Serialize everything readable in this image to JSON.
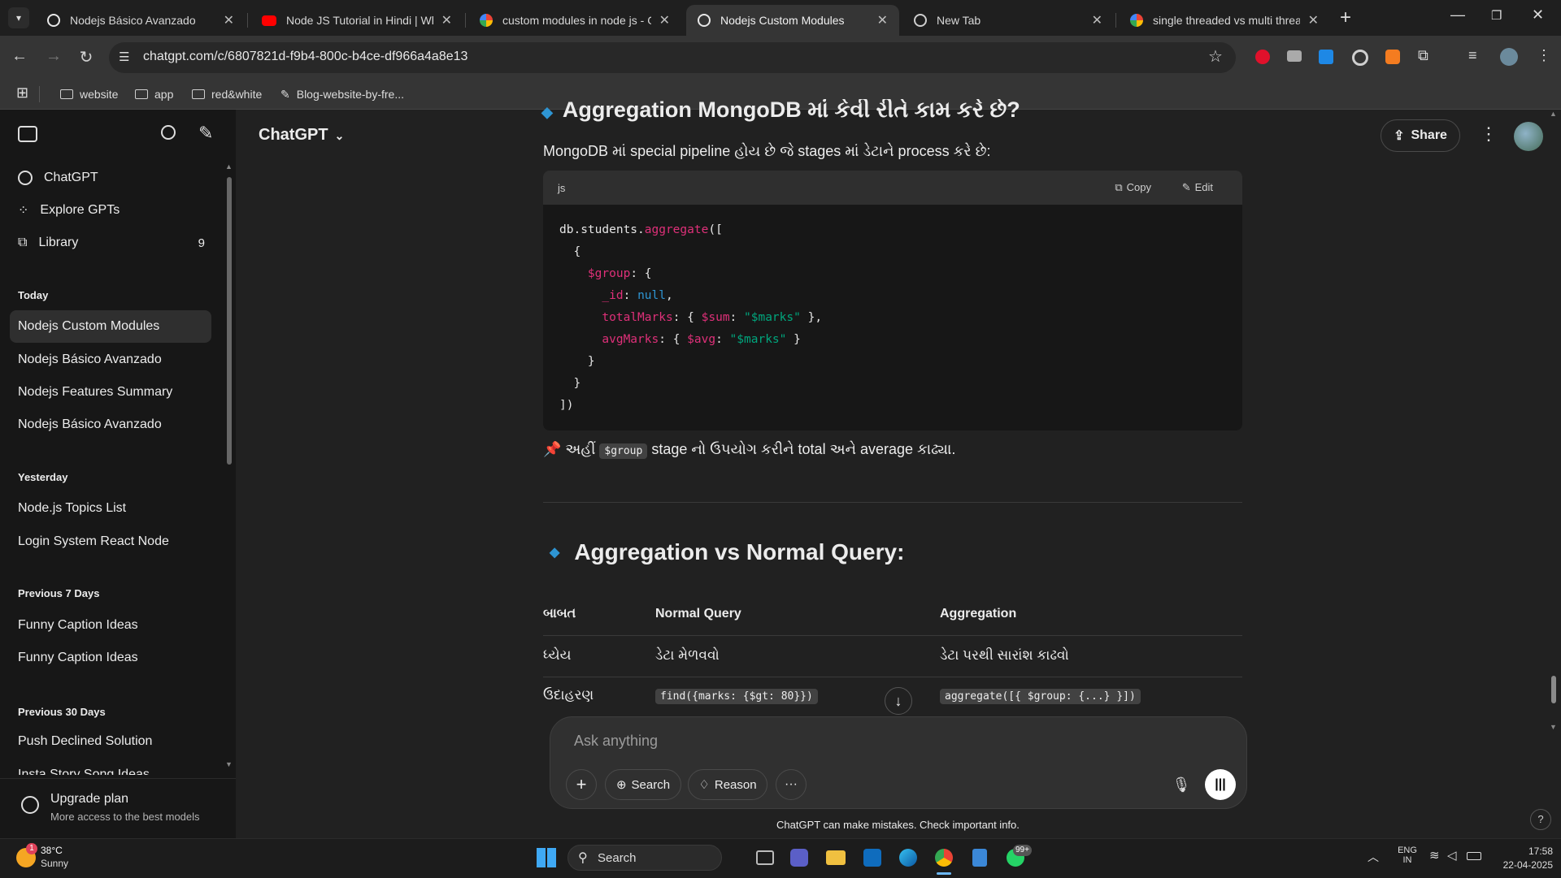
{
  "browser": {
    "tabs": [
      {
        "title": "Nodejs Básico Avanzado",
        "icon": "chatgpt-icon",
        "color": "#ffffff"
      },
      {
        "title": "Node JS Tutorial in Hindi | What",
        "icon": "youtube-icon",
        "color": "#ff0000"
      },
      {
        "title": "custom modules in node js - Go",
        "icon": "google-icon",
        "color": "#4285f4"
      },
      {
        "title": "Nodejs Custom Modules",
        "icon": "chatgpt-icon",
        "color": "#ffffff"
      },
      {
        "title": "New Tab",
        "icon": "chrome-icon",
        "color": "#ffffff"
      },
      {
        "title": "single threaded vs multi thread",
        "icon": "google-icon",
        "color": "#4285f4"
      }
    ],
    "url": "chatgpt.com/c/6807821d-f9b4-800c-b4ce-df966a4a8e13",
    "bookmarks": [
      "website",
      "app",
      "red&white",
      "Blog-website-by-fre..."
    ]
  },
  "sidebar": {
    "top_items": [
      {
        "label": "ChatGPT",
        "icon": "chatgpt-icon"
      },
      {
        "label": "Explore GPTs",
        "icon": "grid-icon"
      },
      {
        "label": "Library",
        "icon": "library-icon",
        "count": "9"
      }
    ],
    "sections": [
      {
        "title": "Today",
        "items": [
          "Nodejs Custom Modules",
          "Nodejs Básico Avanzado",
          "Nodejs Features Summary",
          "Nodejs Básico Avanzado"
        ]
      },
      {
        "title": "Yesterday",
        "items": [
          "Node.js Topics List",
          "Login System React Node"
        ]
      },
      {
        "title": "Previous 7 Days",
        "items": [
          "Funny Caption Ideas",
          "Funny Caption Ideas"
        ]
      },
      {
        "title": "Previous 30 Days",
        "items": [
          "Push Declined Solution",
          "Insta Story Song Ideas"
        ]
      }
    ],
    "upgrade": {
      "title": "Upgrade plan",
      "subtitle": "More access to the best models"
    }
  },
  "header": {
    "model": "ChatGPT",
    "share": "Share"
  },
  "content": {
    "partial_heading": "Aggregation MongoDB માં કેવી રીતે કામ કરે છે?",
    "intro": "MongoDB માં special pipeline હોય છે જે stages માં ડેટાને process કરે છે:",
    "code": {
      "lang": "js",
      "copy": "Copy",
      "edit": "Edit",
      "lines": [
        "db.students.aggregate([",
        "  {",
        "    $group: {",
        "      _id: null,",
        "      totalMarks: { $sum: \"$marks\" },",
        "      avgMarks: { $avg: \"$marks\" }",
        "    }",
        "  }",
        "])"
      ]
    },
    "note_prefix": "📌 અહીં",
    "note_code": "$group",
    "note_suffix": "stage નો ઉપયોગ કરીને total અને average કાઢ્યા.",
    "heading": "Aggregation vs Normal Query:",
    "table": {
      "headers": [
        "બાબત",
        "Normal Query",
        "Aggregation"
      ],
      "rows": [
        [
          "ધ્યેય",
          "ડેટા મેળવવો",
          "ડેટા પરથી સારાંશ કાઢવો"
        ],
        [
          "ઉદાહરણ",
          "find({marks: {$gt: 80}})",
          "aggregate([{ $group: {...} }])"
        ]
      ]
    }
  },
  "composer": {
    "placeholder": "Ask anything",
    "buttons": [
      "Search",
      "Reason"
    ],
    "disclaimer": "ChatGPT can make mistakes. Check important info."
  },
  "taskbar": {
    "weather_temp": "38°C",
    "weather_desc": "Sunny",
    "weather_badge": "1",
    "search": "Search",
    "whatsapp_badge": "99+",
    "lang_top": "ENG",
    "lang_bottom": "IN",
    "time": "17:58",
    "date": "22-04-2025"
  }
}
